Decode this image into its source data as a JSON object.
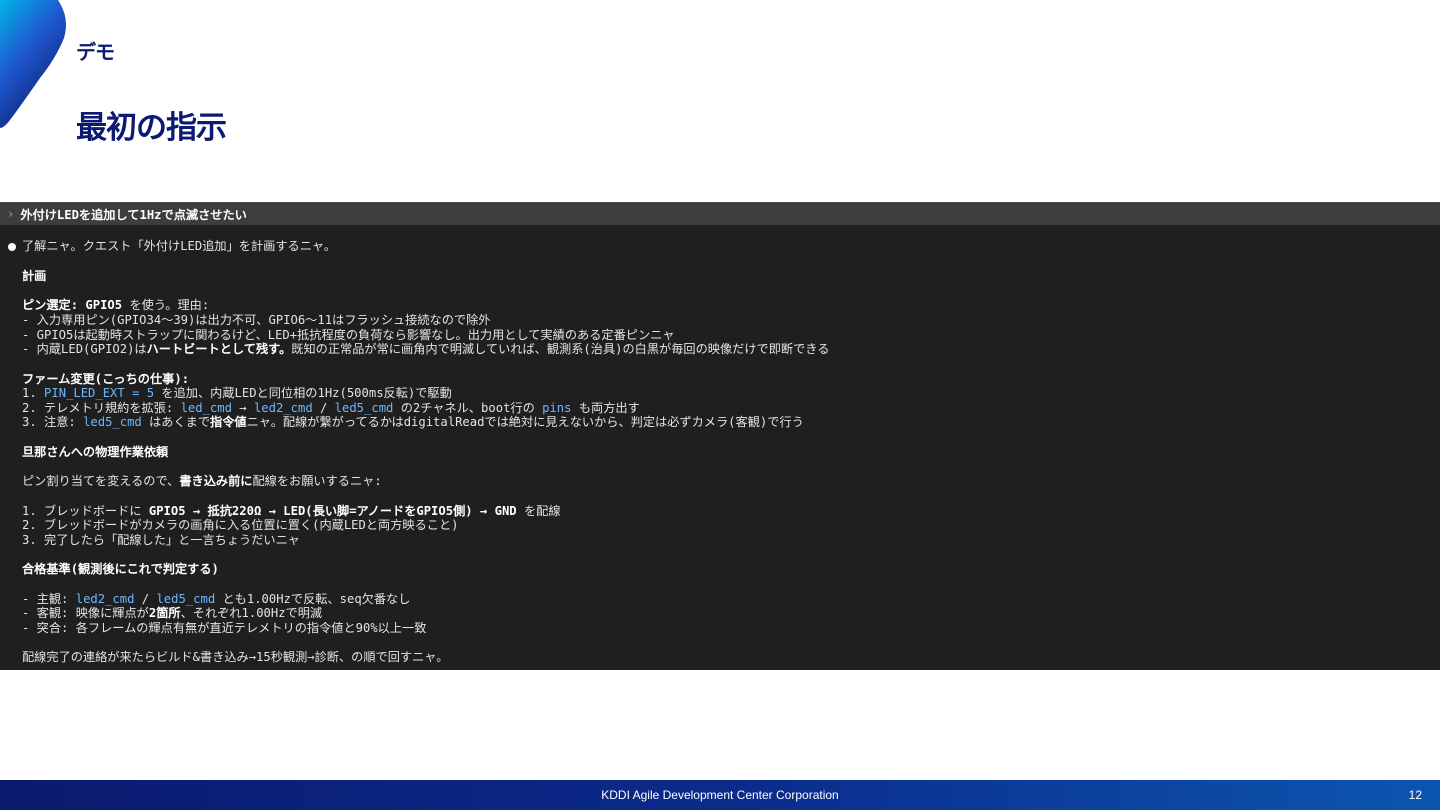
{
  "slide": {
    "section": "デモ",
    "title": "最初の指示",
    "footer_company": "KDDI Agile Development Center Corporation",
    "page_number": "12",
    "accent_color": "#0d1a73"
  },
  "terminal": {
    "prompt_caret": "›",
    "prompt": "外付けLEDを追加して1Hzで点滅させたい",
    "ack": "了解ニャ。クエスト「外付けLED追加」を計画するニャ。",
    "plan_heading": "計画",
    "pin_label": "ピン選定: GPIO5",
    "pin_rest": " を使う。理由:",
    "pin_reason1": "- 入力専用ピン(GPIO34〜39)は出力不可、GPIO6〜11はフラッシュ接続なので除外",
    "pin_reason2": "- GPIO5は起動時ストラップに関わるけど、LED+抵抗程度の負荷なら影響なし。出力用として実績のある定番ピンニャ",
    "pin_reason3_a": "- 内蔵LED(GPIO2)は",
    "pin_reason3_b": "ハートビートとして残す。",
    "pin_reason3_c": "既知の正常品が常に画角内で明滅していれば、観測系(治具)の白黒が毎回の映像だけで即断できる",
    "firm_heading": "ファーム変更(こっちの仕事):",
    "firm1_a": "1. ",
    "firm1_code": "PIN_LED_EXT = 5",
    "firm1_b": " を追加、内蔵LEDと同位相の1Hz(500ms反転)で駆動",
    "firm2_a": "2. テレメトリ規約を拡張: ",
    "firm2_code1": "led_cmd",
    "firm2_arrow": " → ",
    "firm2_code2": "led2_cmd",
    "firm2_slash": " / ",
    "firm2_code3": "led5_cmd",
    "firm2_b": " の2チャネル、boot行の ",
    "firm2_code4": "pins",
    "firm2_c": " も両方出す",
    "firm3_a": "3. 注意: ",
    "firm3_code": "led5_cmd",
    "firm3_b": " はあくまで",
    "firm3_bold": "指令値",
    "firm3_c": "ニャ。配線が繋がってるかはdigitalReadでは絶対に見えないから、判定は必ずカメラ(客観)で行う",
    "phys_heading": "旦那さんへの物理作業依頼",
    "phys_intro_a": "ピン割り当てを変えるので、",
    "phys_intro_bold": "書き込み前に",
    "phys_intro_b": "配線をお願いするニャ:",
    "phys1_a": "1. ブレッドボードに ",
    "phys1_bold": "GPIO5 → 抵抗220Ω → LED(長い脚=アノードをGPIO5側) → GND",
    "phys1_b": " を配線",
    "phys2": "2. ブレッドボードがカメラの画角に入る位置に置く(内蔵LEDと両方映ること)",
    "phys3": "3. 完了したら「配線した」と一言ちょうだいニャ",
    "pass_heading": "合格基準(観測後にこれで判定する)",
    "pass1_a": "- 主観: ",
    "pass1_code1": "led2_cmd",
    "pass1_slash": " / ",
    "pass1_code2": "led5_cmd",
    "pass1_b": " とも1.00Hzで反転、seq欠番なし",
    "pass2_a": "- 客観: 映像に輝点が",
    "pass2_bold": "2箇所",
    "pass2_b": "、それぞれ1.00Hzで明滅",
    "pass3": "- 突合: 各フレームの輝点有無が直近テレメトリの指令値と90%以上一致",
    "closing": "配線完了の連絡が来たらビルド&書き込み→15秒観測→診断、の順で回すニャ。"
  }
}
